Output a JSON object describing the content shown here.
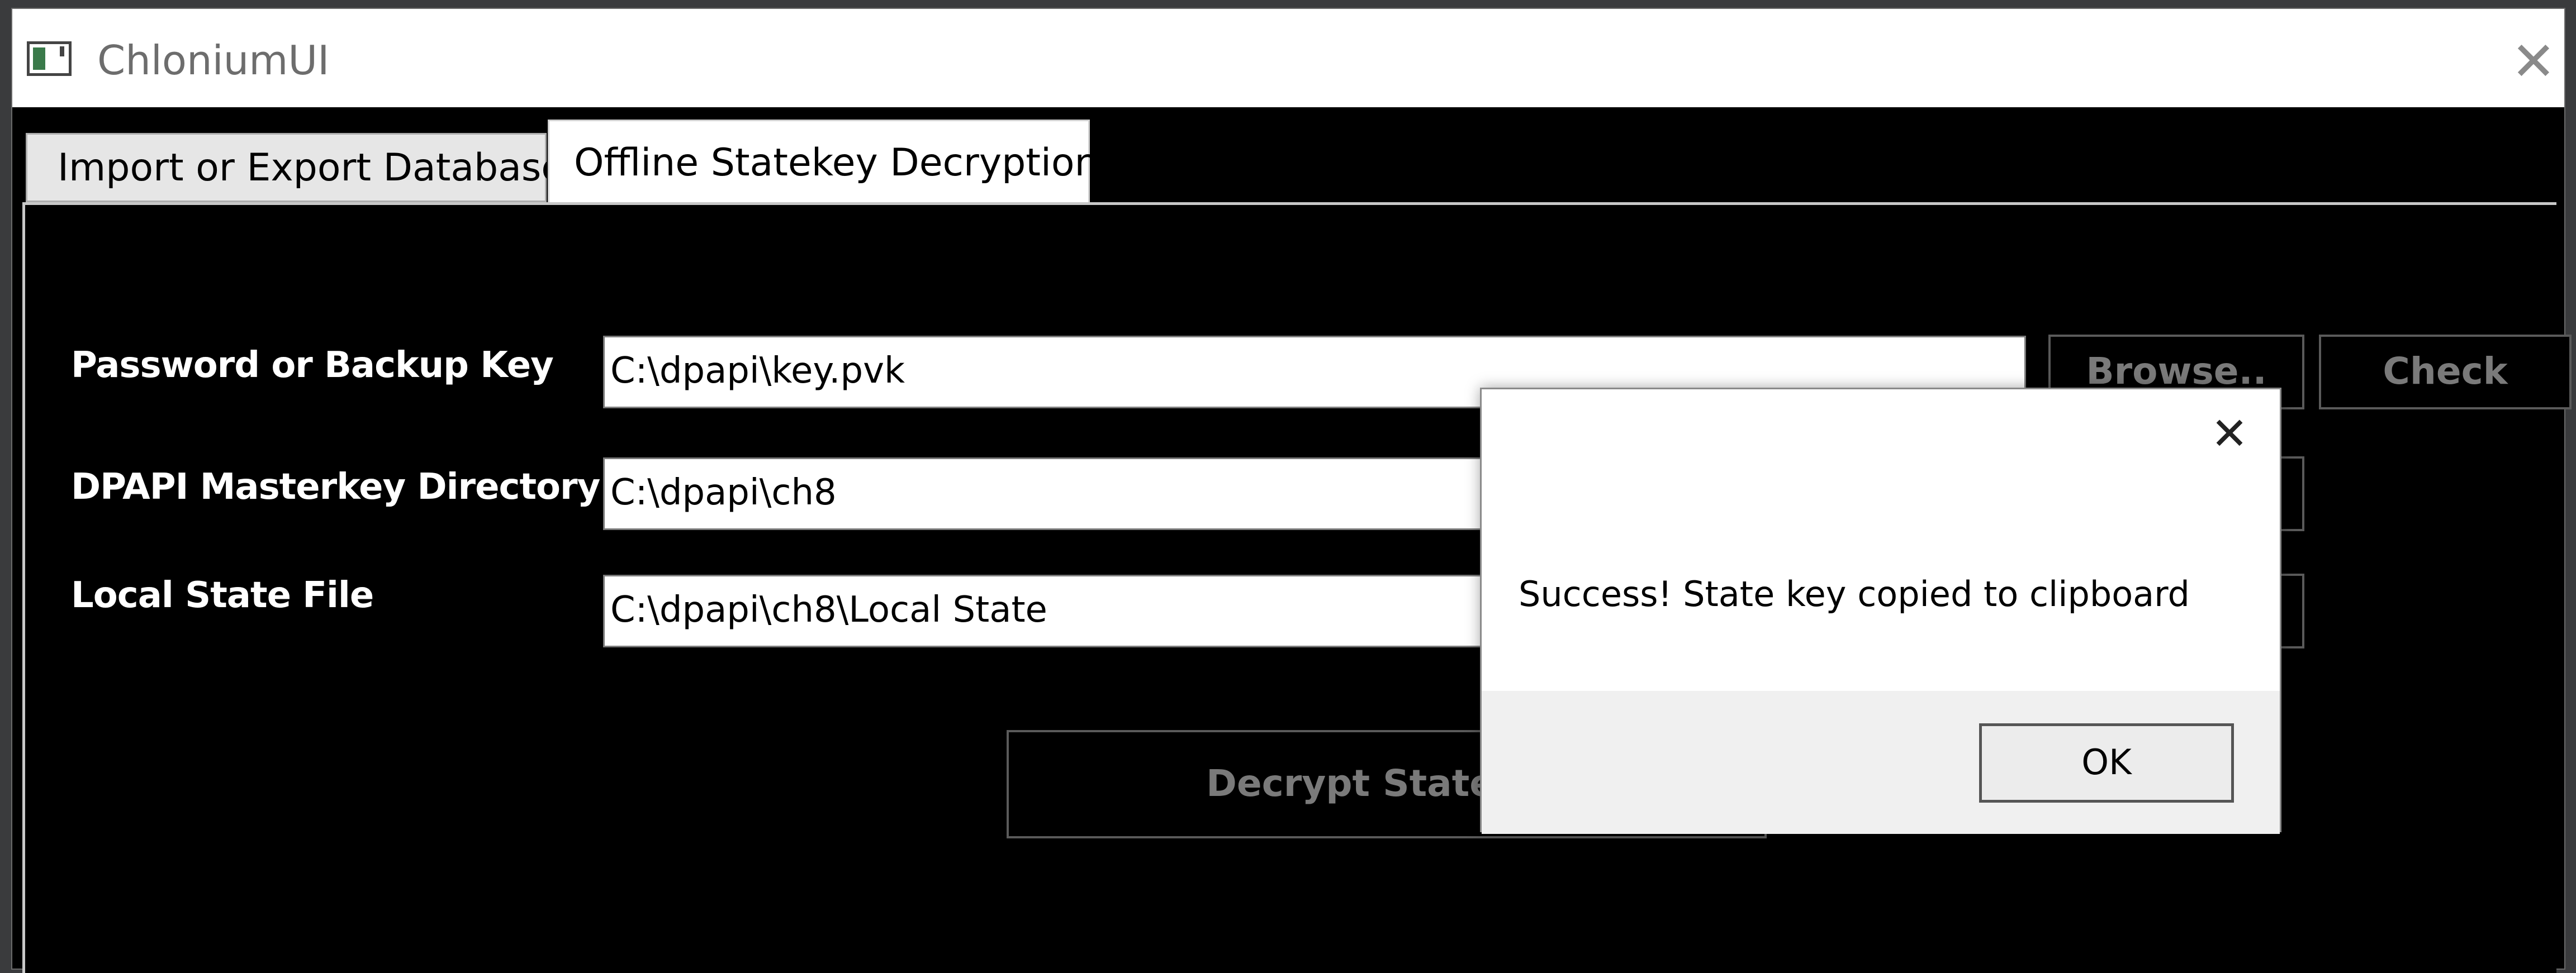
{
  "window": {
    "title": "ChloniumUI",
    "close_glyph": "✕",
    "icon": "app-window-icon"
  },
  "tabs": [
    {
      "label": "Import or Export Database",
      "selected": false
    },
    {
      "label": "Offline Statekey Decryption",
      "selected": true
    }
  ],
  "form": {
    "password": {
      "label": "Password or Backup Key",
      "value": "C:\\dpapi\\key.pvk"
    },
    "masterkey": {
      "label": "DPAPI Masterkey Directory",
      "value": "C:\\dpapi\\ch8"
    },
    "localstate": {
      "label": "Local State File",
      "value": "C:\\dpapi\\ch8\\Local State"
    },
    "browse_label": "Browse..",
    "check_label": "Check",
    "decrypt_label": "Decrypt Statekey"
  },
  "dialog": {
    "message": "Success! State key copied to clipboard",
    "ok_label": "OK",
    "close_glyph": "✕"
  },
  "colors": {
    "panel_bg": "#000000",
    "label_text": "#ffffff",
    "disabled_text": "#7a7a7a"
  }
}
